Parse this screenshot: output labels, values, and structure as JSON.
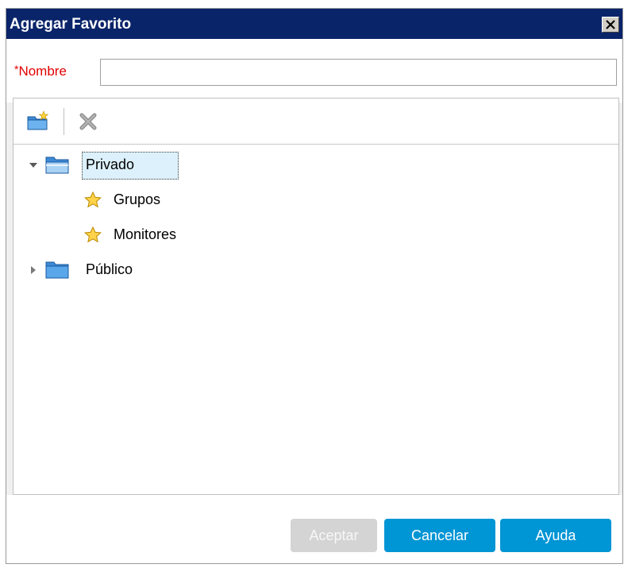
{
  "dialog": {
    "title": "Agregar Favorito",
    "close_symbol": "✕"
  },
  "name_field": {
    "required_mark": "*",
    "label": "Nombre",
    "value": "",
    "placeholder": ""
  },
  "toolbar": {
    "new_folder_icon": "new-folder-icon",
    "delete_icon": "delete-icon"
  },
  "tree": {
    "nodes": [
      {
        "label": "Privado",
        "icon": "folder-open-icon",
        "expanded": true,
        "selected": true
      },
      {
        "label": "Grupos",
        "icon": "star-icon"
      },
      {
        "label": "Monitores",
        "icon": "star-icon"
      },
      {
        "label": "Público",
        "icon": "folder-icon",
        "expanded": false
      }
    ]
  },
  "buttons": {
    "accept": "Aceptar",
    "cancel": "Cancelar",
    "help": "Ayuda"
  },
  "colors": {
    "titlebar": "#0a246a",
    "primary_button": "#0095d5",
    "disabled_button": "#d4d4d4",
    "required": "#e00000",
    "selection": "#dcf1fb"
  }
}
